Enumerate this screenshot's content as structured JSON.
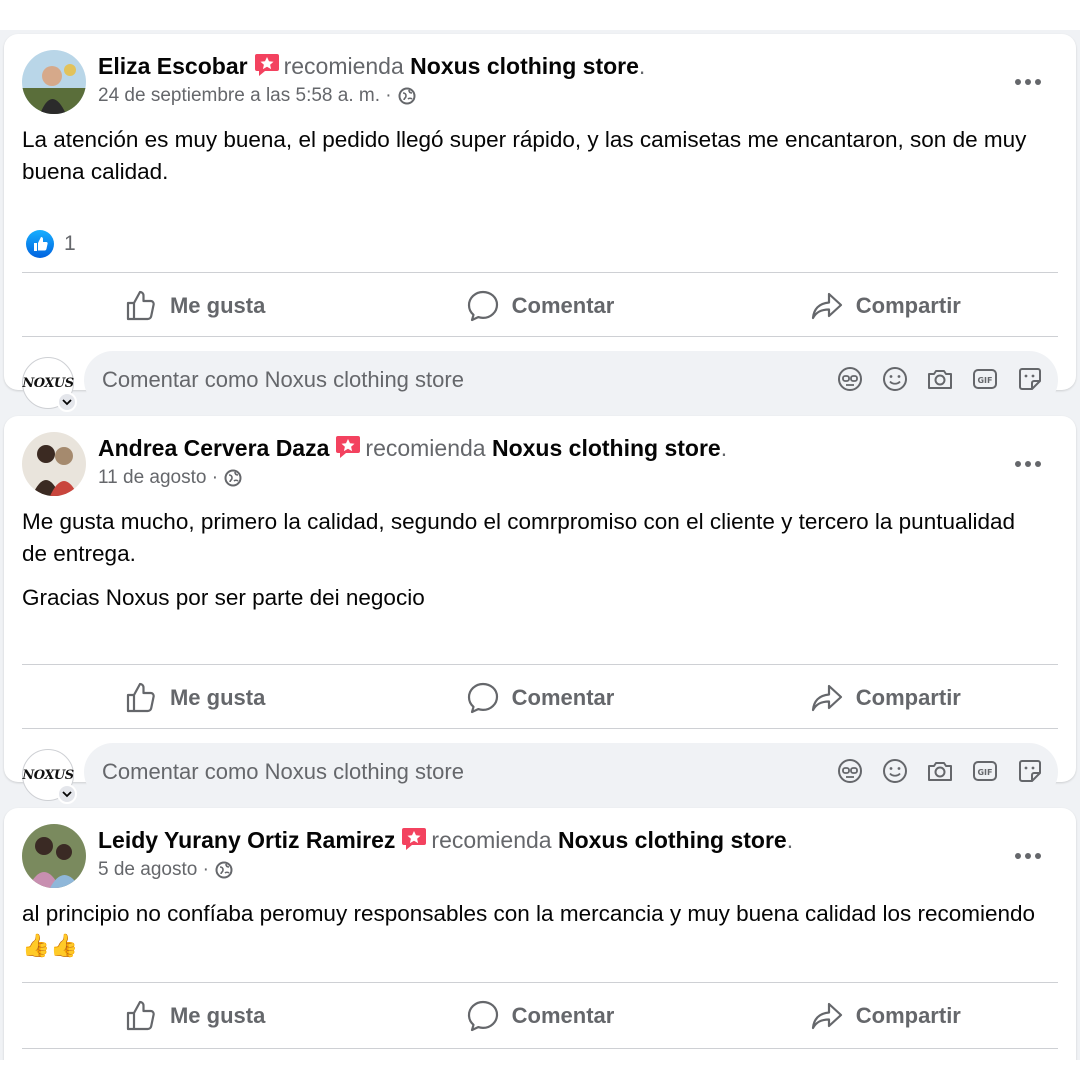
{
  "posts": [
    {
      "author": "Eliza Escobar",
      "recommends_word": "recomienda",
      "store": "Noxus clothing store",
      "period": ".",
      "date": "24 de septiembre a las 5:58 a. m. ·",
      "text": [
        "La atención es muy buena, el pedido llegó super rápido, y las camisetas me encantaron, son de muy buena calidad."
      ],
      "like_count": "1",
      "avatar_colors": [
        "#b9d6e8",
        "#5a6e3a",
        "#d6a98a",
        "#2b2b2b"
      ]
    },
    {
      "author": "Andrea Cervera Daza",
      "recommends_word": "recomienda",
      "store": "Noxus clothing store",
      "period": ".",
      "date": "11 de agosto ·",
      "text": [
        "Me gusta mucho, primero la calidad, segundo el comrpromiso con el cliente y tercero la puntualidad de entrega.",
        "Gracias Noxus por ser parte dei negocio"
      ],
      "avatar_colors": [
        "#e9e4dc",
        "#3b2a22",
        "#c9463d",
        "#a58a6e"
      ]
    },
    {
      "author": "Leidy Yurany Ortiz Ramirez",
      "recommends_word": "recomienda",
      "store": "Noxus clothing store",
      "period": ".",
      "date": "5 de agosto ·",
      "text": [
        "al principio no confíaba peromuy responsables con la mercancia y muy buena calidad los recomiendo 👍👍"
      ],
      "avatar_colors": [
        "#7a8a5e",
        "#c88fb0",
        "#3a2a24",
        "#8fb7d9"
      ]
    }
  ],
  "actions": {
    "like": "Me gusta",
    "comment": "Comentar",
    "share": "Compartir"
  },
  "comment_input": {
    "placeholder": "Comentar como Noxus clothing store"
  },
  "page_avatar_text": "NOXUS",
  "colors": {
    "accent": "#0866ff",
    "secondary_text": "#65676b",
    "badge": "#f3425f",
    "input_bg": "#f0f2f5"
  }
}
